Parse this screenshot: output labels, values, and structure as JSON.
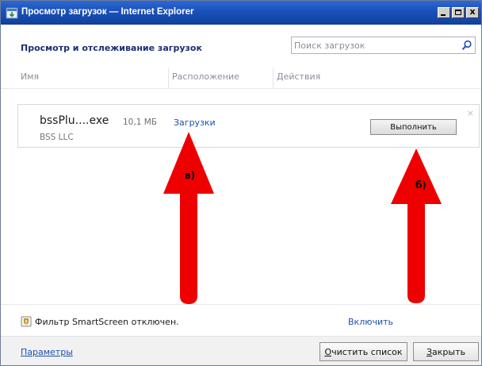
{
  "window": {
    "title": "Просмотр загрузок — Internet Explorer",
    "minimize_icon": "minimize-icon",
    "maximize_icon": "maximize-icon",
    "close_label": "x"
  },
  "header": {
    "title": "Просмотр и отслеживание загрузок",
    "search_placeholder": "Поиск загрузок",
    "search_icon": "search-icon"
  },
  "columns": [
    "Имя",
    "Расположение",
    "Действия"
  ],
  "downloads": [
    {
      "name": "bssPlu....exe",
      "size": "10,1 МБ",
      "publisher": "BSS LLC",
      "location": "Загрузки",
      "action": "Выполнить",
      "dismiss": "×"
    }
  ],
  "annotations": {
    "left_label": "в)",
    "right_label": "б)",
    "arrow_color": "#ee0000"
  },
  "smartscreen": {
    "text": "Фильтр SmartScreen отключен.",
    "enable_link": "Включить",
    "icon": "shield-warning-icon"
  },
  "footer": {
    "params_link": "Параметры",
    "clear_button_hotkey": "О",
    "clear_button_rest": "чистить список",
    "close_button_hotkey": "З",
    "close_button_rest": "акрыть"
  },
  "colors": {
    "titlebar": "#1a50b8",
    "link": "#1d4fb0",
    "heading": "#1a2f74"
  }
}
